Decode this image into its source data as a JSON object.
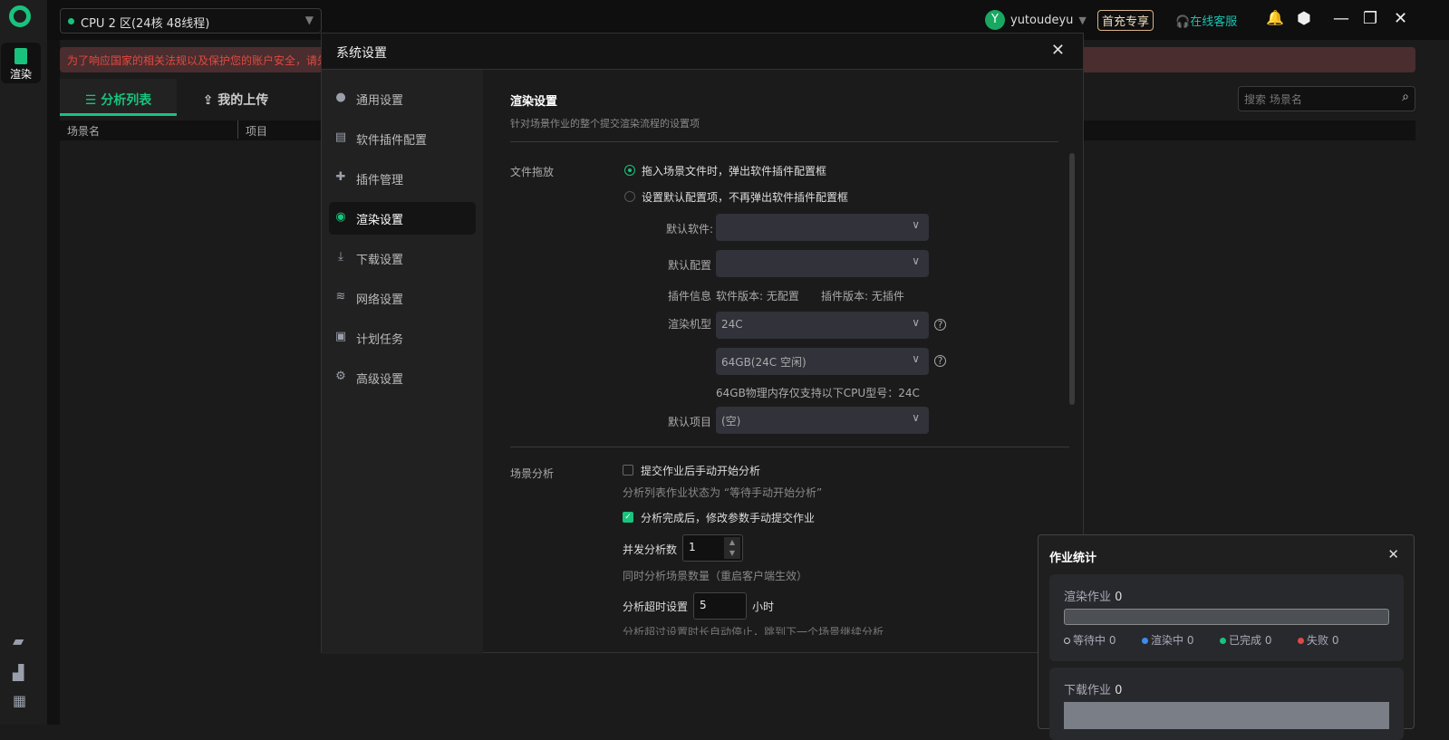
{
  "app": {
    "sidebar": {
      "render_label": "渲染",
      "icons": [
        "folder-icon",
        "chart-icon",
        "qrcode-icon"
      ]
    },
    "cpu_zone": "CPU 2 区(24核 48线程)",
    "banner": "为了响应国家的相关法规以及保护您的账户安全，请先",
    "tabs": [
      {
        "label": "分析列表"
      },
      {
        "label": "我的上传"
      }
    ],
    "table_headers": [
      "场景名",
      "项目"
    ],
    "search_placeholder": "搜索 场景名",
    "user": {
      "avatar": "Y",
      "name": "yutoudeyu"
    },
    "promo": "首充专享",
    "service": "在线客服"
  },
  "dialog": {
    "title": "系统设置",
    "nav": [
      {
        "label": "通用设置"
      },
      {
        "label": "软件插件配置"
      },
      {
        "label": "插件管理"
      },
      {
        "label": "渲染设置"
      },
      {
        "label": "下载设置"
      },
      {
        "label": "网络设置"
      },
      {
        "label": "计划任务"
      },
      {
        "label": "高级设置"
      }
    ],
    "section_title": "渲染设置",
    "section_desc": "针对场景作业的整个提交渲染流程的设置项",
    "file_drop": {
      "label": "文件拖放",
      "option1": "拖入场景文件时，弹出软件插件配置框",
      "option2": "设置默认配置项，不再弹出软件插件配置框",
      "selected": 1,
      "default_software_label": "默认软件:",
      "default_software": "",
      "default_config_label": "默认配置",
      "default_config": "",
      "plugin_info_label": "插件信息",
      "software_version": "软件版本: 无配置",
      "plugin_version": "插件版本: 无插件",
      "machine_label": "渲染机型",
      "machine": "24C",
      "memory": "64GB(24C 空闲)",
      "memory_note": "64GB物理内存仅支持以下CPU型号：24C",
      "default_project_label": "默认项目",
      "default_project": "(空)"
    },
    "analysis": {
      "label": "场景分析",
      "manual_start": "提交作业后手动开始分析",
      "manual_start_checked": false,
      "manual_start_note": "分析列表作业状态为 “等待手动开始分析”",
      "manual_submit": "分析完成后，修改参数手动提交作业",
      "manual_submit_checked": true,
      "concurrency_label": "并发分析数",
      "concurrency": "1",
      "concurrency_note": "同时分析场景数量（重启客户端生效）",
      "timeout_label": "分析超时设置",
      "timeout": "5",
      "timeout_unit": "小时",
      "timeout_note": "分析超过设置时长自动停止，跳到下一个场景继续分析"
    }
  },
  "stats": {
    "title": "作业统计",
    "render": {
      "label": "渲染作业",
      "count": "0",
      "legend": [
        {
          "label": "等待中 0",
          "color": "#2a2a2a"
        },
        {
          "label": "渲染中 0",
          "color": "#3b8cf0"
        },
        {
          "label": "已完成 0",
          "color": "#19c37d"
        },
        {
          "label": "失败 0",
          "color": "#e04848"
        }
      ]
    },
    "download": {
      "label": "下载作业",
      "count": "0"
    }
  }
}
